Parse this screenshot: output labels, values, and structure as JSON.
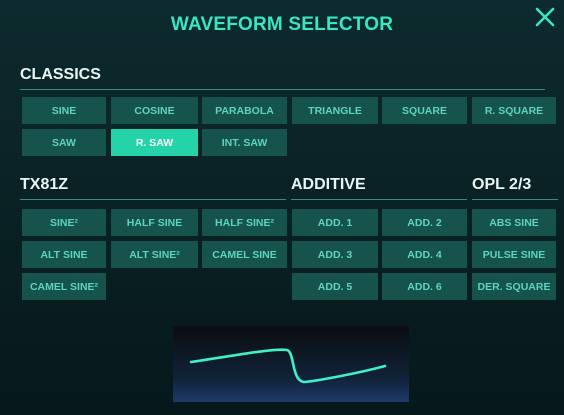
{
  "header": {
    "title": "WAVEFORM SELECTOR",
    "close_icon": "close-x-icon"
  },
  "accent_color": "#38e6c5",
  "selected_color": "#24d4a8",
  "sections": {
    "classics": {
      "title": "CLASSICS",
      "buttons": [
        "SINE",
        "COSINE",
        "PARABOLA",
        "TRIANGLE",
        "SQUARE",
        "R. SQUARE",
        "SAW",
        "R. SAW",
        "INT. SAW"
      ]
    },
    "tx81z": {
      "title": "TX81Z",
      "buttons": [
        "SINE²",
        "HALF SINE",
        "HALF SINE²",
        "ALT SINE",
        "ALT SINE²",
        "CAMEL SINE",
        "CAMEL SINE²"
      ]
    },
    "additive": {
      "title": "ADDITIVE",
      "buttons": [
        "ADD. 1",
        "ADD. 2",
        "ADD. 3",
        "ADD. 4",
        "ADD. 5",
        "ADD. 6"
      ]
    },
    "opl": {
      "title": "OPL 2/3",
      "buttons": [
        "ABS SINE",
        "PULSE SINE",
        "DER. SQUARE"
      ]
    }
  },
  "selected_waveform": "R. SAW"
}
